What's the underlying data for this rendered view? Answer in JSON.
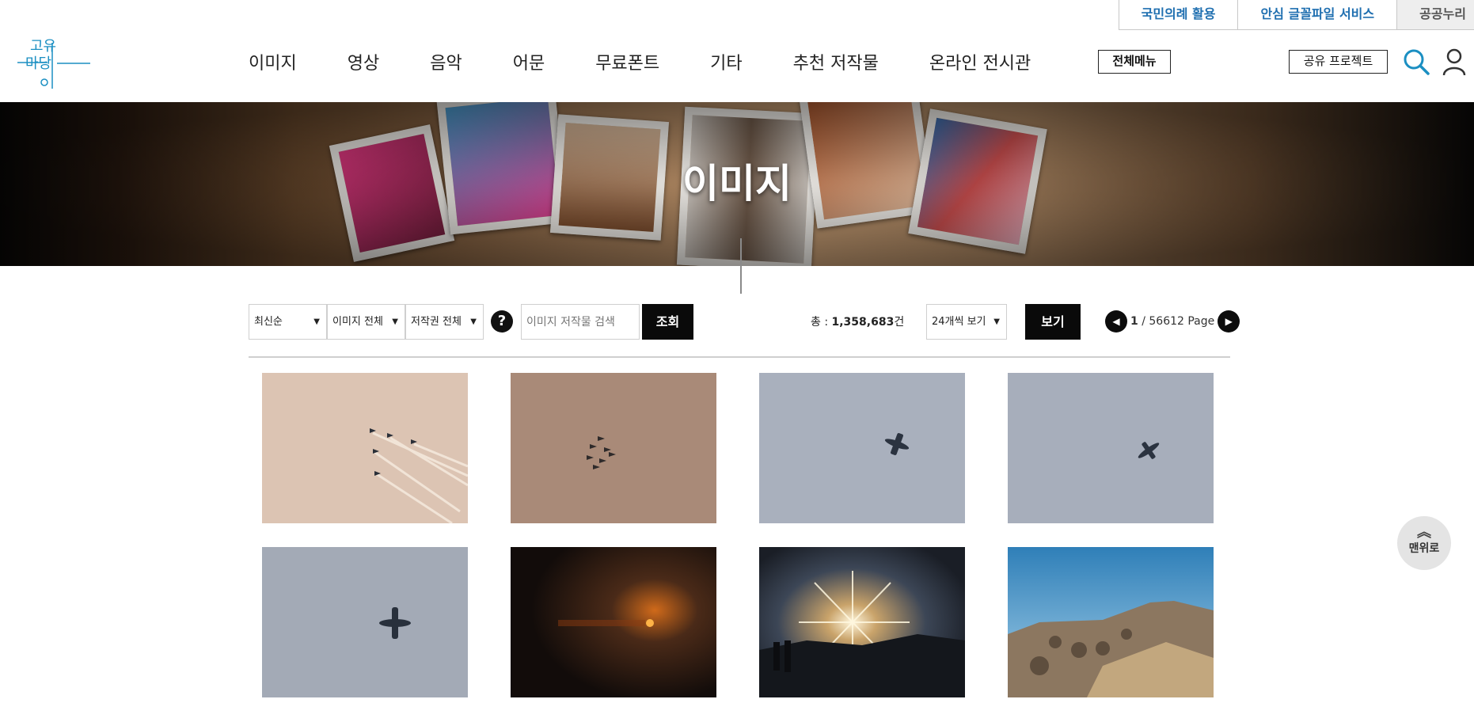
{
  "utility_links": [
    {
      "label": "국민의례 활용"
    },
    {
      "label": "안심 글꼴파일 서비스"
    },
    {
      "label": "공공누리"
    }
  ],
  "logo": {
    "text": "공유마당",
    "color": "#1b8fc2"
  },
  "nav": [
    {
      "label": "이미지"
    },
    {
      "label": "영상"
    },
    {
      "label": "음악"
    },
    {
      "label": "어문"
    },
    {
      "label": "무료폰트"
    },
    {
      "label": "기타"
    },
    {
      "label": "추천 저작물"
    },
    {
      "label": "온라인 전시관"
    }
  ],
  "header": {
    "all_menu_label": "전체메뉴",
    "share_project_label": "공유 프로젝트",
    "icons": [
      "search-icon",
      "user-icon"
    ]
  },
  "banner": {
    "title": "이미지"
  },
  "filters": {
    "sort": {
      "selected": "최신순"
    },
    "type": {
      "selected": "이미지 전체"
    },
    "rights": {
      "selected": "저작권 전체"
    },
    "help_label": "?",
    "search_placeholder": "이미지 저작물 검색",
    "search_button": "조회",
    "total_prefix": "총 : ",
    "total_count": "1,358,683",
    "total_suffix": "건",
    "per_page": {
      "selected": "24개씩 보기"
    },
    "view_button": "보기"
  },
  "pagination": {
    "current": "1",
    "separator": " / ",
    "total": "56612",
    "suffix": " Page"
  },
  "gallery": [
    {
      "subject": "jet formation with smoke trails"
    },
    {
      "subject": "aircraft formation"
    },
    {
      "subject": "single jet"
    },
    {
      "subject": "single jet"
    },
    {
      "subject": "transport aircraft"
    },
    {
      "subject": "sunset over dark water"
    },
    {
      "subject": "sun burst over mountains with silhouettes"
    },
    {
      "subject": "rocky mountain summit"
    }
  ],
  "scroll_top": {
    "label": "맨위로"
  }
}
